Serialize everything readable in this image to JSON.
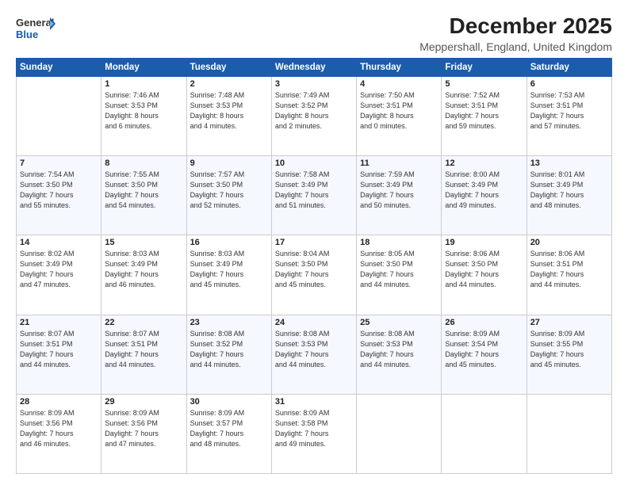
{
  "header": {
    "logo_line1": "General",
    "logo_line2": "Blue",
    "title": "December 2025",
    "subtitle": "Meppershall, England, United Kingdom"
  },
  "columns": [
    "Sunday",
    "Monday",
    "Tuesday",
    "Wednesday",
    "Thursday",
    "Friday",
    "Saturday"
  ],
  "weeks": [
    [
      {
        "day": "",
        "info": ""
      },
      {
        "day": "1",
        "info": "Sunrise: 7:46 AM\nSunset: 3:53 PM\nDaylight: 8 hours\nand 6 minutes."
      },
      {
        "day": "2",
        "info": "Sunrise: 7:48 AM\nSunset: 3:53 PM\nDaylight: 8 hours\nand 4 minutes."
      },
      {
        "day": "3",
        "info": "Sunrise: 7:49 AM\nSunset: 3:52 PM\nDaylight: 8 hours\nand 2 minutes."
      },
      {
        "day": "4",
        "info": "Sunrise: 7:50 AM\nSunset: 3:51 PM\nDaylight: 8 hours\nand 0 minutes."
      },
      {
        "day": "5",
        "info": "Sunrise: 7:52 AM\nSunset: 3:51 PM\nDaylight: 7 hours\nand 59 minutes."
      },
      {
        "day": "6",
        "info": "Sunrise: 7:53 AM\nSunset: 3:51 PM\nDaylight: 7 hours\nand 57 minutes."
      }
    ],
    [
      {
        "day": "7",
        "info": "Sunrise: 7:54 AM\nSunset: 3:50 PM\nDaylight: 7 hours\nand 55 minutes."
      },
      {
        "day": "8",
        "info": "Sunrise: 7:55 AM\nSunset: 3:50 PM\nDaylight: 7 hours\nand 54 minutes."
      },
      {
        "day": "9",
        "info": "Sunrise: 7:57 AM\nSunset: 3:50 PM\nDaylight: 7 hours\nand 52 minutes."
      },
      {
        "day": "10",
        "info": "Sunrise: 7:58 AM\nSunset: 3:49 PM\nDaylight: 7 hours\nand 51 minutes."
      },
      {
        "day": "11",
        "info": "Sunrise: 7:59 AM\nSunset: 3:49 PM\nDaylight: 7 hours\nand 50 minutes."
      },
      {
        "day": "12",
        "info": "Sunrise: 8:00 AM\nSunset: 3:49 PM\nDaylight: 7 hours\nand 49 minutes."
      },
      {
        "day": "13",
        "info": "Sunrise: 8:01 AM\nSunset: 3:49 PM\nDaylight: 7 hours\nand 48 minutes."
      }
    ],
    [
      {
        "day": "14",
        "info": "Sunrise: 8:02 AM\nSunset: 3:49 PM\nDaylight: 7 hours\nand 47 minutes."
      },
      {
        "day": "15",
        "info": "Sunrise: 8:03 AM\nSunset: 3:49 PM\nDaylight: 7 hours\nand 46 minutes."
      },
      {
        "day": "16",
        "info": "Sunrise: 8:03 AM\nSunset: 3:49 PM\nDaylight: 7 hours\nand 45 minutes."
      },
      {
        "day": "17",
        "info": "Sunrise: 8:04 AM\nSunset: 3:50 PM\nDaylight: 7 hours\nand 45 minutes."
      },
      {
        "day": "18",
        "info": "Sunrise: 8:05 AM\nSunset: 3:50 PM\nDaylight: 7 hours\nand 44 minutes."
      },
      {
        "day": "19",
        "info": "Sunrise: 8:06 AM\nSunset: 3:50 PM\nDaylight: 7 hours\nand 44 minutes."
      },
      {
        "day": "20",
        "info": "Sunrise: 8:06 AM\nSunset: 3:51 PM\nDaylight: 7 hours\nand 44 minutes."
      }
    ],
    [
      {
        "day": "21",
        "info": "Sunrise: 8:07 AM\nSunset: 3:51 PM\nDaylight: 7 hours\nand 44 minutes."
      },
      {
        "day": "22",
        "info": "Sunrise: 8:07 AM\nSunset: 3:51 PM\nDaylight: 7 hours\nand 44 minutes."
      },
      {
        "day": "23",
        "info": "Sunrise: 8:08 AM\nSunset: 3:52 PM\nDaylight: 7 hours\nand 44 minutes."
      },
      {
        "day": "24",
        "info": "Sunrise: 8:08 AM\nSunset: 3:53 PM\nDaylight: 7 hours\nand 44 minutes."
      },
      {
        "day": "25",
        "info": "Sunrise: 8:08 AM\nSunset: 3:53 PM\nDaylight: 7 hours\nand 44 minutes."
      },
      {
        "day": "26",
        "info": "Sunrise: 8:09 AM\nSunset: 3:54 PM\nDaylight: 7 hours\nand 45 minutes."
      },
      {
        "day": "27",
        "info": "Sunrise: 8:09 AM\nSunset: 3:55 PM\nDaylight: 7 hours\nand 45 minutes."
      }
    ],
    [
      {
        "day": "28",
        "info": "Sunrise: 8:09 AM\nSunset: 3:56 PM\nDaylight: 7 hours\nand 46 minutes."
      },
      {
        "day": "29",
        "info": "Sunrise: 8:09 AM\nSunset: 3:56 PM\nDaylight: 7 hours\nand 47 minutes."
      },
      {
        "day": "30",
        "info": "Sunrise: 8:09 AM\nSunset: 3:57 PM\nDaylight: 7 hours\nand 48 minutes."
      },
      {
        "day": "31",
        "info": "Sunrise: 8:09 AM\nSunset: 3:58 PM\nDaylight: 7 hours\nand 49 minutes."
      },
      {
        "day": "",
        "info": ""
      },
      {
        "day": "",
        "info": ""
      },
      {
        "day": "",
        "info": ""
      }
    ]
  ]
}
